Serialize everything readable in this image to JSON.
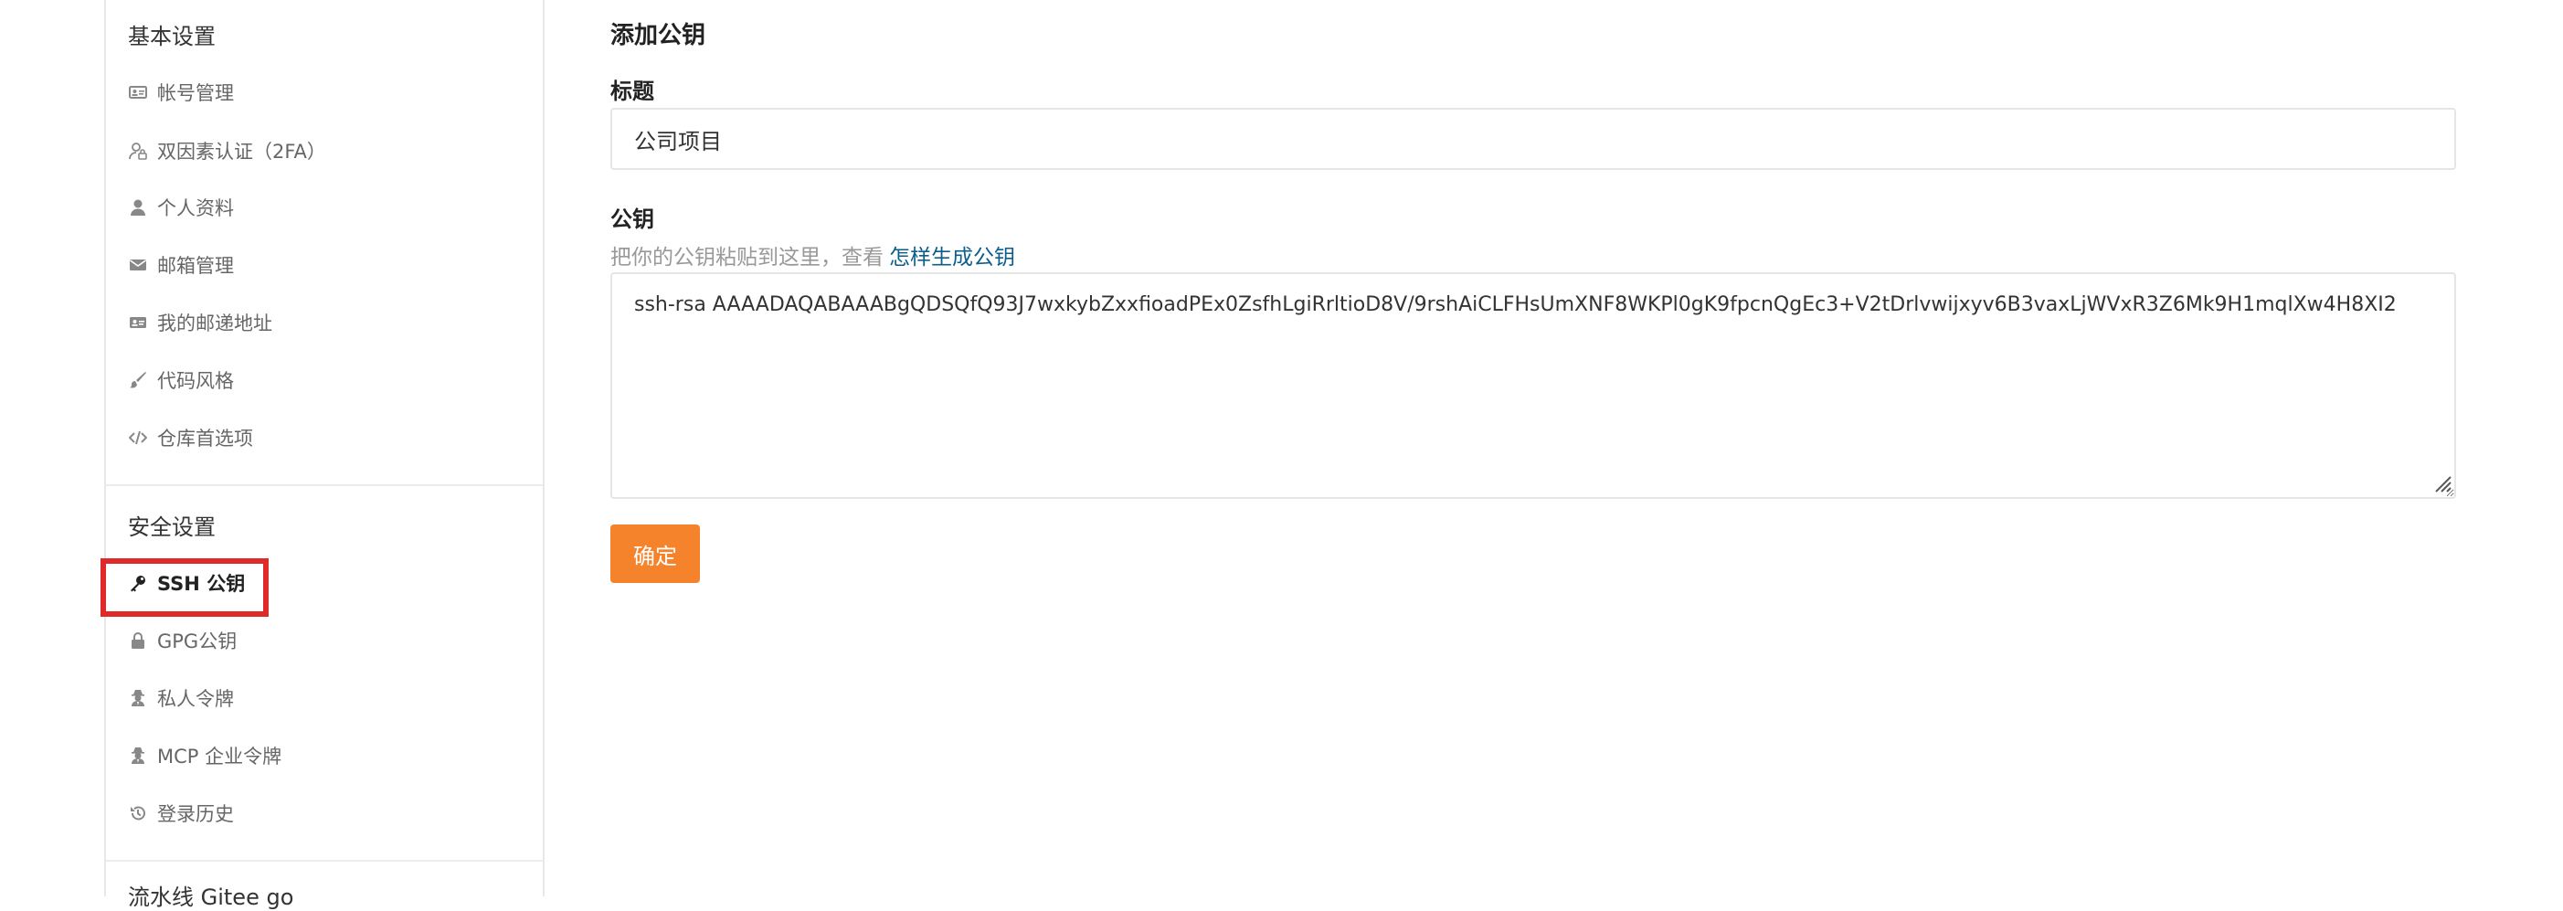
{
  "sidebar": {
    "sections": [
      {
        "title": "基本设置",
        "items": [
          {
            "label": "帐号管理",
            "icon": "id-card-icon"
          },
          {
            "label": "双因素认证（2FA）",
            "icon": "user-lock-icon"
          },
          {
            "label": "个人资料",
            "icon": "user-icon"
          },
          {
            "label": "邮箱管理",
            "icon": "envelope-icon"
          },
          {
            "label": "我的邮递地址",
            "icon": "address-card-icon"
          },
          {
            "label": "代码风格",
            "icon": "brush-icon"
          },
          {
            "label": "仓库首选项",
            "icon": "code-icon"
          }
        ]
      },
      {
        "title": "安全设置",
        "items": [
          {
            "label": "SSH 公钥",
            "icon": "key-icon",
            "active": true
          },
          {
            "label": "GPG公钥",
            "icon": "lock-icon"
          },
          {
            "label": "私人令牌",
            "icon": "user-secret-icon"
          },
          {
            "label": "MCP 企业令牌",
            "icon": "user-secret-icon"
          },
          {
            "label": "登录历史",
            "icon": "history-icon"
          }
        ]
      },
      {
        "title": "流水线 Gitee go"
      }
    ]
  },
  "form": {
    "page_title": "添加公钥",
    "title_label": "标题",
    "title_value": "公司项目",
    "key_label": "公钥",
    "key_hint": "把你的公钥粘贴到这里，查看",
    "key_hint_link": "怎样生成公钥",
    "key_value": "ssh-rsa AAAADAQABAAABgQDSQfQ93J7wxkybZxxfioadPEx0ZsfhLgiRrltioD8V/9rshAiCLFHsUmXNF8WKPl0gK9fpcnQgEc3+V2tDrlvwijxyv6B3vaxLjWVxR3Z6Mk9H1mqlXw4H8XI2",
    "submit_label": "确定"
  },
  "colors": {
    "accent": "#f5832b",
    "link": "#0b5f8a",
    "highlight": "#e02a2a"
  }
}
